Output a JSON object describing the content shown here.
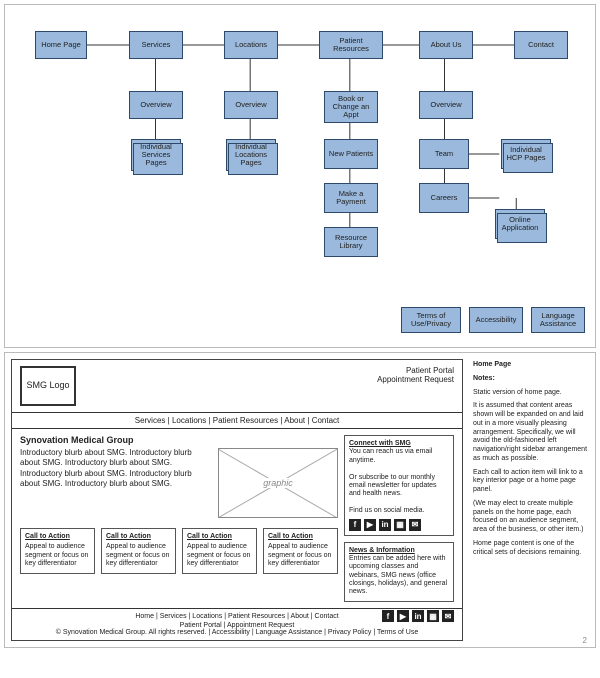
{
  "sitemap": {
    "top": [
      "Home Page",
      "Services",
      "Locations",
      "Patient Resources",
      "About Us",
      "Contact"
    ],
    "services": {
      "overview": "Overview",
      "pages": "Individual Services Pages"
    },
    "locations": {
      "overview": "Overview",
      "pages": "Individual Locations Pages"
    },
    "patient": {
      "book": "Book or Change an Appt",
      "new": "New Patients",
      "pay": "Make a Payment",
      "lib": "Resource Library"
    },
    "about": {
      "overview": "Overview",
      "team": "Team",
      "hcp": "Individual HCP Pages",
      "careers": "Careers",
      "apply": "Online Application"
    },
    "footer": [
      "Terms of Use/Privacy",
      "Accessibility",
      "Language Assistance"
    ]
  },
  "wf": {
    "logo": "SMG Logo",
    "toplinks": [
      "Patient Portal",
      "Appointment Request"
    ],
    "nav": [
      "Services",
      "Locations",
      "Patient Resources",
      "About",
      "Contact"
    ],
    "title": "Synovation Medical Group",
    "intro": "Introductory blurb about SMG. Introductory blurb about SMG. Introductory blurb about SMG. Introductory blurb about SMG. Introductory blurb about SMG. Introductory blurb about SMG.",
    "graphic_label": "graphic",
    "cta": {
      "title": "Call to Action",
      "body": "Appeal to audience segment or focus on key differentiator"
    },
    "connect": {
      "title": "Connect with SMG",
      "l1": "You can reach us via email anytime.",
      "l2": "Or subscribe to our monthly email newsletter for updates and health news.",
      "l3": "Find us on social media."
    },
    "news": {
      "title": "News & Information",
      "body": "Entries can be added here with upcoming classes and webinars, SMG news (office closings, holidays), and general news."
    },
    "footer_nav": [
      "Home",
      "Services",
      "Locations",
      "Patient Resources",
      "About",
      "Contact"
    ],
    "footer_line2": "Patient Portal | Appointment Request",
    "footer_line3": "© Synovation Medical Group. All rights reserved. | Accessibility | Language Assistance | Privacy Policy | Terms of Use",
    "page_num": "2"
  },
  "notes": {
    "title": "Home Page",
    "label": "Notes:",
    "p1": "Static version of home page.",
    "p2": "It is assumed that content areas shown will be expanded on and laid out in a more visually pleasing arrangement. Specifically, we will avoid the old-fashioned left navigation/right sidebar arrangement as much as possible.",
    "p3": "Each call to action item will link to a key interior page or a home page panel.",
    "p4": "(We may elect to create multiple panels on the home page, each focused on an audience segment, area of the business, or other item.)",
    "p5": "Home page content is one of the critical sets of decisions remaining."
  },
  "social_icons": [
    "f",
    "▶",
    "in",
    "▦",
    "✉"
  ]
}
